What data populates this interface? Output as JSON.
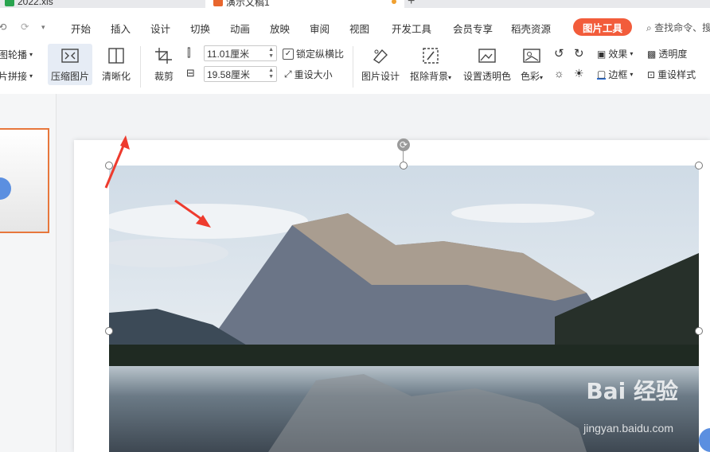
{
  "tabs": [
    {
      "label": "2022.xls",
      "color": "#2aa44f"
    },
    {
      "label": "演示文稿1",
      "color": "#e8662e"
    }
  ],
  "new_tab": "+",
  "menu": [
    "开始",
    "插入",
    "设计",
    "切换",
    "动画",
    "放映",
    "审阅",
    "视图",
    "开发工具",
    "会员专享",
    "稻壳资源"
  ],
  "active_tool": "图片工具",
  "search_label": "查找命令、搜",
  "ribbon": {
    "slideshow": "图轮播",
    "stitch": "片拼接",
    "compress": "压缩图片",
    "sharpen": "清晰化",
    "crop": "裁剪",
    "height": "11.01厘米",
    "width": "19.58厘米",
    "lock_ratio": "锁定纵横比",
    "reset_size": "重设大小",
    "design": "图片设计",
    "remove_bg": "抠除背景",
    "set_transparent": "设置透明色",
    "color": "色彩",
    "effects": "效果",
    "transparency": "透明度",
    "border": "边框",
    "reset_style": "重设样式"
  },
  "watermark": {
    "brand": "Bai 经验",
    "url": "jingyan.baidu.com"
  },
  "accent": "#f25c3b"
}
